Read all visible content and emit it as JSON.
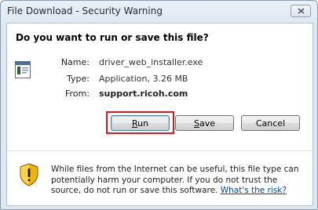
{
  "window": {
    "title": "File Download - Security Warning",
    "close_icon": "close-icon"
  },
  "dialog": {
    "question": "Do you want to run or save this file?",
    "file_icon": "executable-file-icon",
    "fields": {
      "name_label": "Name:",
      "name_value": "driver_web_installer.exe",
      "type_label": "Type:",
      "type_value": "Application, 3.26 MB",
      "from_label": "From:",
      "from_value": "support.ricoh.com"
    }
  },
  "buttons": {
    "run_accel": "R",
    "run_rest": "un",
    "save_accel": "S",
    "save_rest": "ave",
    "cancel": "Cancel"
  },
  "highlight_color": "#e0161f",
  "warning": {
    "icon": "security-shield-icon",
    "text": "While files from the Internet can be useful, this file type can potentially harm your computer. If you do not trust the source, do not run or save this software.",
    "link": "What's the risk?"
  }
}
